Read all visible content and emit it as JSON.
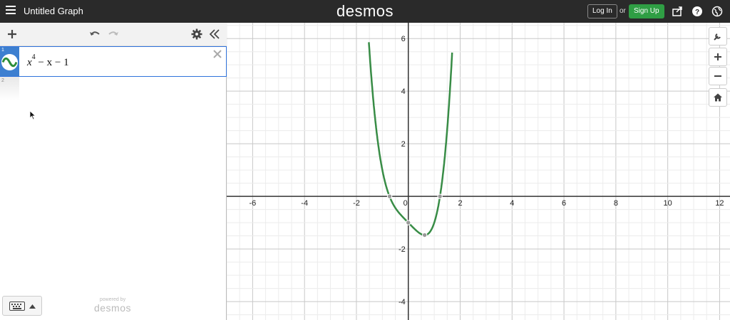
{
  "header": {
    "title": "Untitled Graph",
    "logo": "desmos",
    "login_label": "Log In",
    "or_label": "or",
    "signup_label": "Sign Up",
    "icons": [
      "menu-icon",
      "share-icon",
      "help-icon",
      "globe-icon"
    ]
  },
  "sidebar": {
    "toolbar_icons": [
      "add-icon",
      "undo-icon",
      "redo-icon",
      "gear-icon",
      "collapse-icon"
    ],
    "expressions": [
      {
        "number": "1",
        "latex_base": "x",
        "latex_exp": "4",
        "latex_rest": " − x − 1",
        "color": "#2d8e3a"
      },
      {
        "number": "2"
      }
    ],
    "powered_by": "powered by",
    "powered_logo": "desmos"
  },
  "graph_controls": [
    "wrench-icon",
    "zoom-in-icon",
    "zoom-out-icon",
    "home-icon"
  ],
  "chart_data": {
    "type": "line",
    "function": "x^4 - x - 1",
    "series": [
      {
        "x": [
          -1.46,
          -1.3,
          -1.1,
          -0.9,
          -0.72,
          -0.5,
          -0.3,
          0,
          0.3,
          0.63,
          0.9,
          1.1,
          1.22,
          1.4,
          1.53,
          1.65
        ],
        "y": [
          6.5,
          3.15,
          1.56,
          0.56,
          0.0,
          -0.44,
          -0.69,
          -1.0,
          -1.29,
          -1.47,
          -1.24,
          -0.64,
          0.0,
          1.44,
          3.0,
          5.76
        ]
      }
    ],
    "points": [
      {
        "x": -0.72,
        "y": 0
      },
      {
        "x": 0,
        "y": -1
      },
      {
        "x": 0.63,
        "y": -1.47
      },
      {
        "x": 1.22,
        "y": 0
      }
    ],
    "xlim": [
      -7,
      12.4
    ],
    "ylim": [
      -4.7,
      6.6
    ],
    "x_ticks": [
      "-6",
      "-4",
      "-2",
      "0",
      "2",
      "4",
      "6",
      "8",
      "10",
      "12"
    ],
    "y_ticks": [
      "6",
      "4",
      "2",
      "-2",
      "-4"
    ],
    "grid": true,
    "curve_color": "#388c46"
  }
}
